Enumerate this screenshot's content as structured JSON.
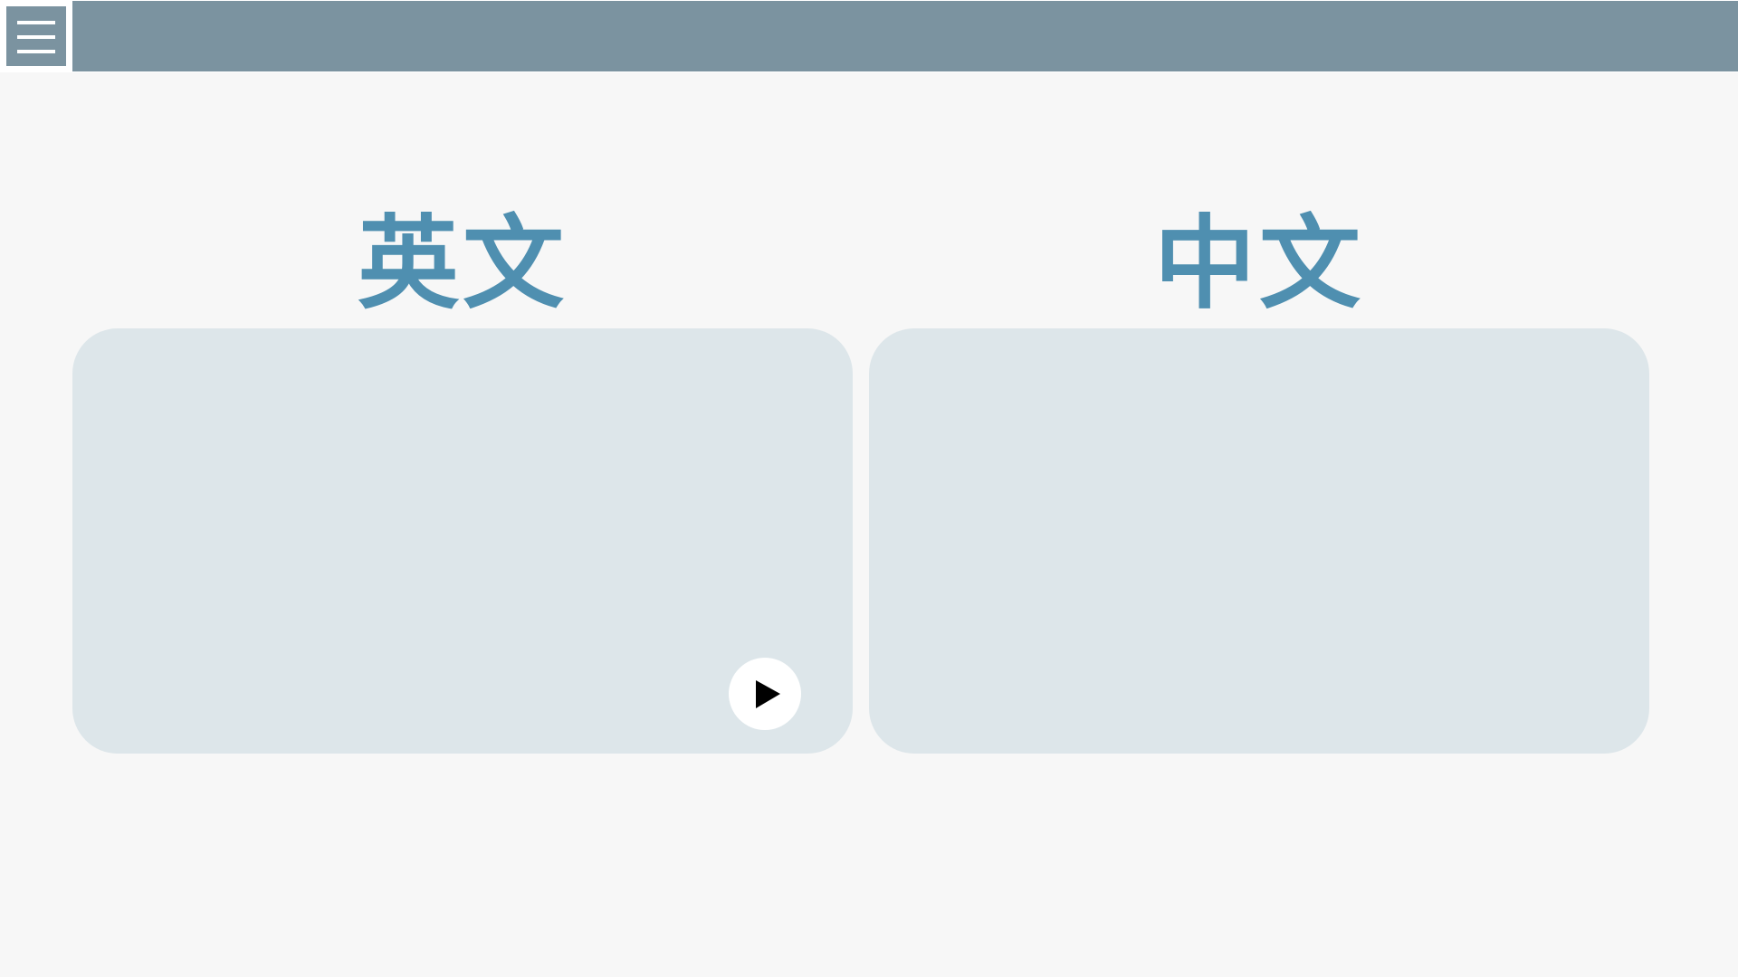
{
  "header": {
    "menu_icon": "hamburger-menu-icon",
    "bar_color": "#7b93a0"
  },
  "columns": [
    {
      "heading": "英文",
      "panel_text": ""
    },
    {
      "heading": "中文",
      "panel_text": ""
    }
  ],
  "player": {
    "play_icon": "play-icon"
  },
  "colors": {
    "accent": "#4f8fb0",
    "panel_bg": "#dde6ea",
    "page_bg": "#f7f7f7"
  }
}
